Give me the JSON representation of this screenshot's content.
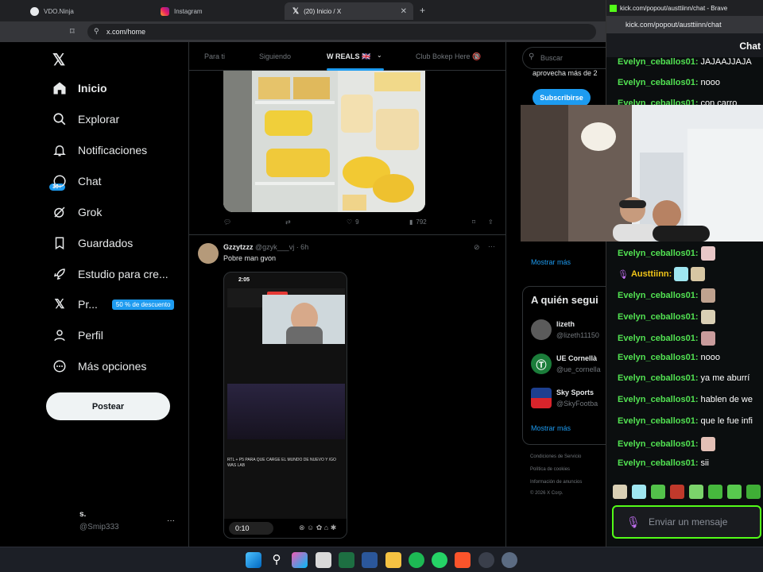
{
  "browser": {
    "tabs": [
      {
        "label": "VDO.Ninja"
      },
      {
        "label": "Instagram"
      },
      {
        "label": "(20) Inicio / X"
      }
    ],
    "url": "x.com/home"
  },
  "sidebar": {
    "items": [
      {
        "label": "Inicio",
        "icon": "home-icon"
      },
      {
        "label": "Explorar",
        "icon": "search-icon"
      },
      {
        "label": "Notificaciones",
        "icon": "bell-icon",
        "badge": "30+"
      },
      {
        "label": "Chat",
        "icon": "chat-icon"
      },
      {
        "label": "Grok",
        "icon": "grok-icon"
      },
      {
        "label": "Guardados",
        "icon": "bookmark-icon"
      },
      {
        "label": "Estudio para cre...",
        "icon": "rocket-icon"
      },
      {
        "label": "Pr...",
        "icon": "x-logo-icon",
        "tag": "50 % de descuento"
      },
      {
        "label": "Perfil",
        "icon": "person-icon"
      },
      {
        "label": "Más opciones",
        "icon": "more-circle-icon"
      }
    ],
    "post_button": "Postear",
    "account": {
      "name": "s.",
      "handle": "@Smip333",
      "more": "···"
    }
  },
  "timeline": {
    "tabs": [
      "Para ti",
      "Siguiendo",
      "W REALS 🇬🇧",
      "Club Bokep Here 🔞"
    ],
    "tweet1": {
      "likes": "9",
      "views": "792"
    },
    "tweet2": {
      "name": "Gzzytzzz",
      "handle": "@gzyk___vj · 6h",
      "text": "Pobre man gvon",
      "video_time": "0:10",
      "video_clock": "2:05",
      "video_caption": "RTL + P5 PARA QUE CARGE EL MUNDO DE NUEVO Y /GO WAS LAB"
    }
  },
  "rightcol": {
    "search_placeholder": "Buscar",
    "premium_text": "aprovecha más de 2",
    "subscribe": "Subscribirse",
    "show_more": "Mostrar más",
    "who_to_follow": "A quién segui",
    "follow_list": [
      {
        "name": "lizeth",
        "handle": "@lizeth11150"
      },
      {
        "name": "UE Cornellà",
        "handle": "@ue_cornella"
      },
      {
        "name": "Sky Sports",
        "handle": "@SkyFootba"
      }
    ],
    "show_more2": "Mostrar más",
    "footer": [
      "Condiciones de Servicio",
      "Política de cookies",
      "Información de anuncios",
      "© 2026 X Corp."
    ]
  },
  "kick": {
    "window_title": "kick.com/popout/austtiinn/chat - Brave",
    "url": "kick.com/popout/austtiinn/chat",
    "header": "Chat",
    "messages": [
      {
        "user": "Evelyn_ceballos01:",
        "text": "JAJAAJJAJA"
      },
      {
        "user": "Evelyn_ceballos01:",
        "text": "nooo"
      },
      {
        "user": "Evelyn_ceballos01:",
        "text": "con carro"
      },
      {
        "user": "Evelyn_ceballos01:",
        "text": ""
      },
      {
        "user": "Austtiinn:",
        "text": ""
      },
      {
        "user": "Evelyn_ceballos01:",
        "text": ""
      },
      {
        "user": "Evelyn_ceballos01:",
        "text": ""
      },
      {
        "user": "Evelyn_ceballos01:",
        "text": ""
      },
      {
        "user": "Evelyn_ceballos01:",
        "text": "nooo"
      },
      {
        "user": "Evelyn_ceballos01:",
        "text": "ya me aburrí"
      },
      {
        "user": "Evelyn_ceballos01:",
        "text": "hablen de we"
      },
      {
        "user": "Evelyn_ceballos01:",
        "text": "que le fue infi"
      },
      {
        "user": "Evelyn_ceballos01:",
        "text": ""
      },
      {
        "user": "Evelyn_ceballos01:",
        "text": "sii"
      }
    ],
    "input_placeholder": "Enviar un mensaje"
  }
}
